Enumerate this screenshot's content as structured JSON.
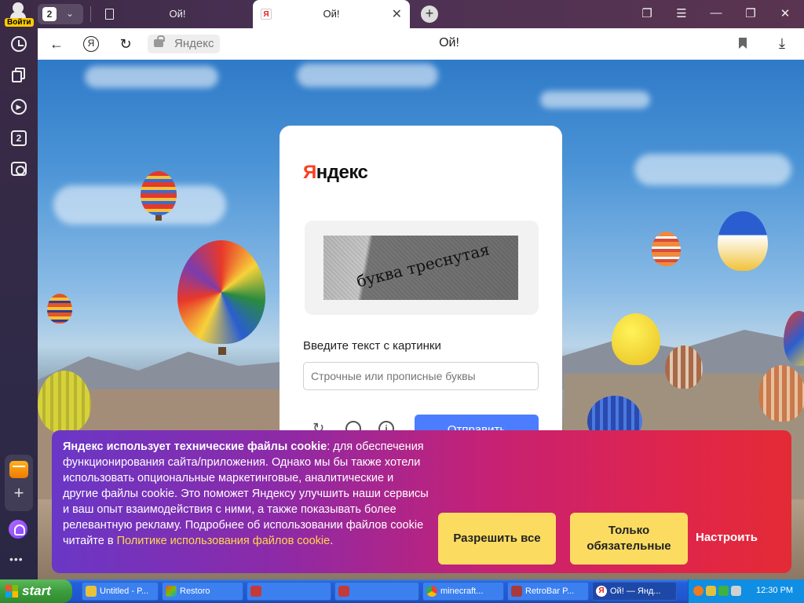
{
  "titlebar": {
    "login_label": "Войти",
    "tab_count": "2",
    "tabs": [
      {
        "title": "Ой!"
      },
      {
        "title": "Ой!",
        "favicon_letter": "Я"
      }
    ]
  },
  "addressbar": {
    "domain": "Яндекс",
    "page_title": "Ой!"
  },
  "sidebar": {
    "collections_count": "2"
  },
  "captcha": {
    "logo_main": "Яндекс",
    "logo_first_letter": "Я",
    "logo_rest": "ндекс",
    "captcha_image_text": "буква треснутая",
    "prompt_label": "Введите текст с картинки",
    "input_placeholder": "Строчные или прописные буквы",
    "submit_label": "Отправить"
  },
  "cookie_banner": {
    "bold_text": "Яндекс использует технические файлы cookie",
    "body_text": ": для обеспечения функционирования сайта/приложения. Однако мы бы также хотели использовать опциональные маркетинговые, аналитические и другие файлы cookie. Это поможет Яндексу улучшить наши сервисы и ваш опыт взаимодействия с ними, а также показывать более релевантную рекламу. Подробнее об использовании файлов cookie читайте в ",
    "link_text": "Политике использования файлов cookie",
    "end_text": ".",
    "allow_all_label": "Разрешить все",
    "necessary_only_label": "Только обязательные",
    "settings_label": "Настроить",
    "accent_color": "#fbdc61"
  },
  "taskbar": {
    "start_label": "start",
    "items": [
      {
        "label": "Untitled - P...",
        "icon": "paint-icon"
      },
      {
        "label": "Restoro",
        "icon": "restoro-icon"
      },
      {
        "label": "",
        "icon": "app-icon"
      },
      {
        "label": "",
        "icon": "app-icon"
      },
      {
        "label": "minecraft...",
        "icon": "chrome-icon"
      },
      {
        "label": "RetroBar P...",
        "icon": "retrobar-icon"
      },
      {
        "label": "Ой! — Янд...",
        "icon": "yandex-icon"
      }
    ],
    "clock": "12:30 PM"
  }
}
